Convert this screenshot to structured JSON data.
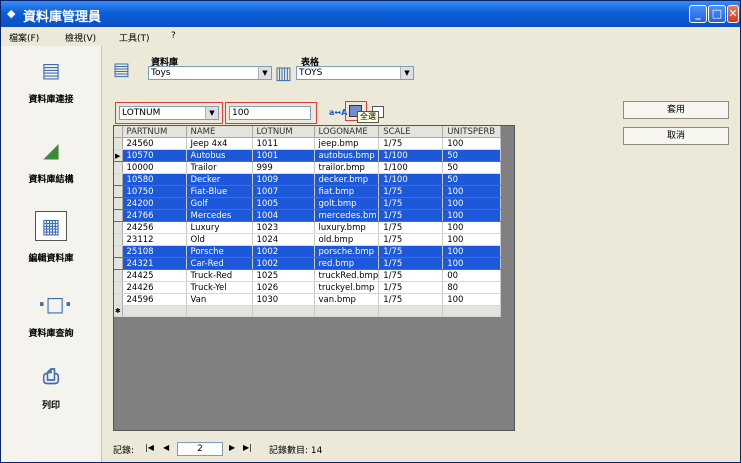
{
  "window": {
    "title": "資料庫管理員"
  },
  "menu": [
    "檔案(F)",
    "檢視(V)",
    "工具(T)",
    "?"
  ],
  "sidebar": {
    "items": [
      {
        "label": "資料庫連接",
        "icon": "database-connect-icon"
      },
      {
        "label": "資料庫結構",
        "icon": "database-structure-icon"
      },
      {
        "label": "編輯資料庫",
        "icon": "edit-database-icon"
      },
      {
        "label": "資料庫查詢",
        "icon": "database-query-icon"
      },
      {
        "label": "列印",
        "icon": "print-icon"
      }
    ]
  },
  "database": {
    "label": "資料庫",
    "value": "Toys"
  },
  "table_select": {
    "label": "表格",
    "value": "TOYS"
  },
  "filter": {
    "field": "LOTNUM",
    "value": "100",
    "sort_icon": "az-sort-icon",
    "tooltip": "全選"
  },
  "buttons": {
    "apply": "套用",
    "cancel": "取消"
  },
  "grid": {
    "columns": [
      "PARTNUM",
      "NAME",
      "LOTNUM",
      "LOGONAME",
      "SCALE",
      "UNITSPERB"
    ],
    "rows": [
      {
        "sel": false,
        "cells": [
          "24560",
          "Jeep 4x4",
          "1011",
          "jeep.bmp",
          "1/75",
          "100"
        ]
      },
      {
        "sel": true,
        "current": true,
        "cells": [
          "10570",
          "Autobus",
          "1001",
          "autobus.bmp",
          "1/100",
          "50"
        ]
      },
      {
        "sel": false,
        "cells": [
          "10000",
          "Trailor",
          "999",
          "trailor.bmp",
          "1/100",
          "50"
        ]
      },
      {
        "sel": true,
        "cells": [
          "10580",
          "Decker",
          "1009",
          "decker.bmp",
          "1/100",
          "50"
        ]
      },
      {
        "sel": true,
        "cells": [
          "10750",
          "Fiat-Blue",
          "1007",
          "fiat.bmp",
          "1/75",
          "100"
        ]
      },
      {
        "sel": true,
        "cells": [
          "24200",
          "Golf",
          "1005",
          "golt.bmp",
          "1/75",
          "100"
        ]
      },
      {
        "sel": true,
        "cells": [
          "24766",
          "Mercedes",
          "1004",
          "mercedes.bm",
          "1/75",
          "100"
        ]
      },
      {
        "sel": false,
        "cells": [
          "24256",
          "Luxury",
          "1023",
          "luxury.bmp",
          "1/75",
          "100"
        ]
      },
      {
        "sel": false,
        "cells": [
          "23112",
          "Old",
          "1024",
          "old.bmp",
          "1/75",
          "100"
        ]
      },
      {
        "sel": true,
        "cells": [
          "25108",
          "Porsche",
          "1002",
          "porsche.bmp",
          "1/75",
          "100"
        ]
      },
      {
        "sel": true,
        "cells": [
          "24321",
          "Car-Red",
          "1002",
          "red.bmp",
          "1/75",
          "100"
        ]
      },
      {
        "sel": false,
        "cells": [
          "24425",
          "Truck-Red",
          "1025",
          "truckRed.bmp",
          "1/75",
          "00"
        ]
      },
      {
        "sel": false,
        "cells": [
          "24426",
          "Truck-Yel",
          "1026",
          "truckyel.bmp",
          "1/75",
          "80"
        ]
      },
      {
        "sel": false,
        "cells": [
          "24596",
          "Van",
          "1030",
          "van.bmp",
          "1/75",
          "100"
        ]
      }
    ]
  },
  "navigator": {
    "record_label": "記錄:",
    "current": "2",
    "count_label": "記錄數目: 14"
  }
}
